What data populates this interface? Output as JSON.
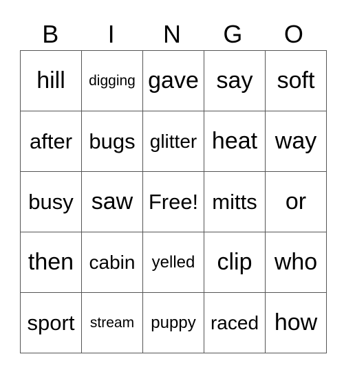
{
  "header": [
    "B",
    "I",
    "N",
    "G",
    "O"
  ],
  "rows": [
    [
      "hill",
      "digging",
      "gave",
      "say",
      "soft"
    ],
    [
      "after",
      "bugs",
      "glitter",
      "heat",
      "way"
    ],
    [
      "busy",
      "saw",
      "Free!",
      "mitts",
      "or"
    ],
    [
      "then",
      "cabin",
      "yelled",
      "clip",
      "who"
    ],
    [
      "sport",
      "stream",
      "puppy",
      "raced",
      "how"
    ]
  ]
}
